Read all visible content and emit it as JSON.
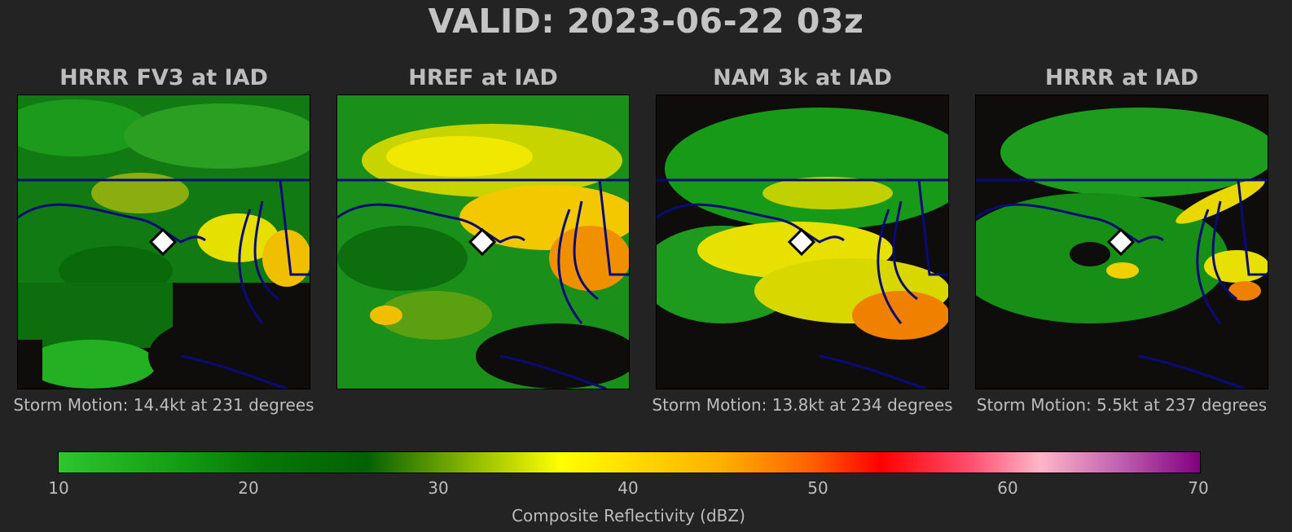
{
  "title": "VALID: 2023-06-22 03z",
  "panels": [
    {
      "title": "HRRR FV3 at IAD",
      "storm_motion": "Storm Motion: 14.4kt at 231 degrees"
    },
    {
      "title": "HREF at IAD",
      "storm_motion": ""
    },
    {
      "title": "NAM 3k at IAD",
      "storm_motion": "Storm Motion: 13.8kt at 234 degrees"
    },
    {
      "title": "HRRR at IAD",
      "storm_motion": "Storm Motion: 5.5kt at 237 degrees"
    }
  ],
  "colorbar": {
    "label": "Composite Reflectivity (dBZ)",
    "ticks": [
      "10",
      "20",
      "30",
      "40",
      "50",
      "60",
      "70"
    ],
    "range": [
      10,
      70
    ]
  },
  "colors": {
    "background": "#232323",
    "map_no_echo": "#0f0c0c",
    "borders": "#0a0a78",
    "marker": "#ffffff"
  },
  "marker_icon": "white-diamond"
}
